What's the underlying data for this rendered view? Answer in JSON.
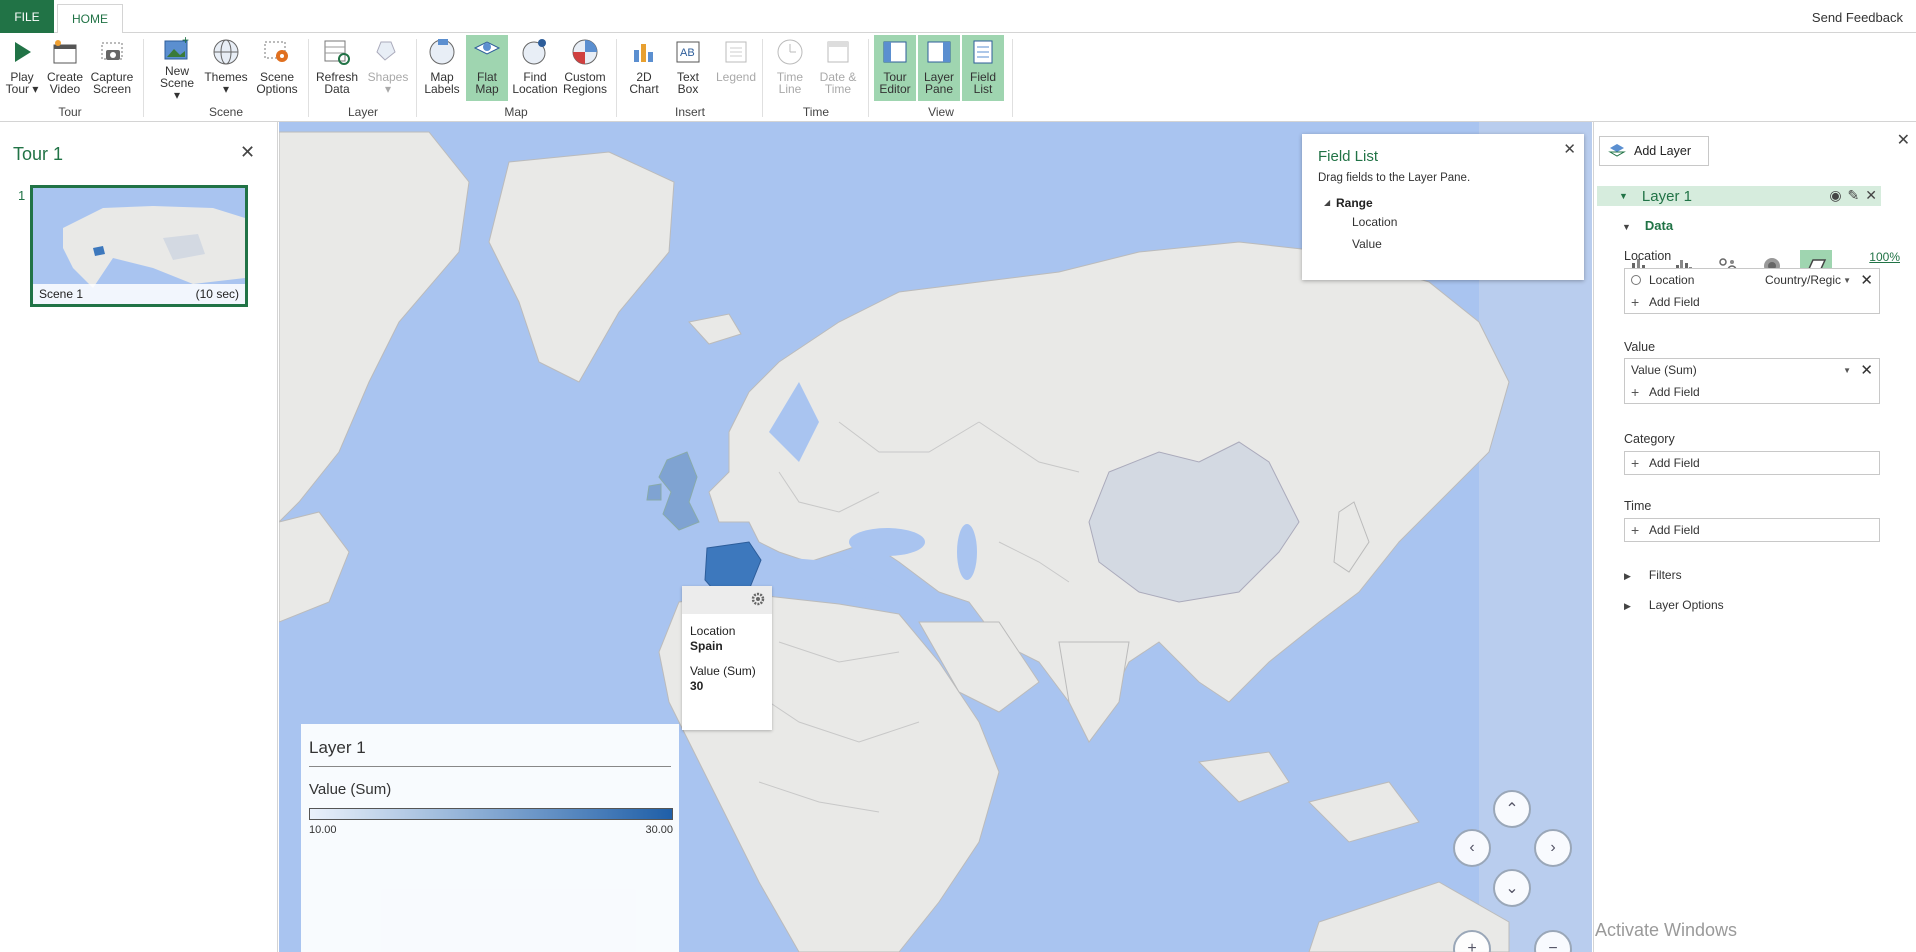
{
  "tabs": {
    "file": "FILE",
    "home": "HOME",
    "send_feedback": "Send Feedback"
  },
  "ribbon": {
    "groups": {
      "tour": "Tour",
      "scene": "Scene",
      "layer": "Layer",
      "map": "Map",
      "insert": "Insert",
      "time": "Time",
      "view": "View"
    },
    "buttons": {
      "play_tour": [
        "Play",
        "Tour ▾"
      ],
      "create_video": [
        "Create",
        "Video"
      ],
      "capture_screen": [
        "Capture",
        "Screen"
      ],
      "new_scene": [
        "New",
        "Scene ▾"
      ],
      "themes": [
        "Themes",
        "▾"
      ],
      "scene_options": [
        "Scene",
        "Options"
      ],
      "refresh_data": [
        "Refresh",
        "Data"
      ],
      "shapes": [
        "Shapes",
        "▾"
      ],
      "map_labels": [
        "Map",
        "Labels"
      ],
      "flat_map": [
        "Flat",
        "Map"
      ],
      "find_location": [
        "Find",
        "Location"
      ],
      "custom_regions": [
        "Custom",
        "Regions"
      ],
      "chart_2d": [
        "2D",
        "Chart"
      ],
      "text_box": [
        "Text",
        "Box"
      ],
      "legend": [
        "Legend",
        ""
      ],
      "time_line": [
        "Time",
        "Line"
      ],
      "date_time": [
        "Date &",
        "Time"
      ],
      "tour_editor": [
        "Tour",
        "Editor"
      ],
      "layer_pane": [
        "Layer",
        "Pane"
      ],
      "field_list": [
        "Field",
        "List"
      ]
    }
  },
  "tour_pane": {
    "title": "Tour 1",
    "close": "✕",
    "scenes": [
      {
        "number": "1",
        "name": "Scene 1",
        "duration": "(10 sec)"
      }
    ]
  },
  "legend": {
    "title": "Layer 1",
    "field": "Value (Sum)",
    "min": "10.00",
    "max": "30.00"
  },
  "tooltip": {
    "location_label": "Location",
    "location_value": "Spain",
    "value_label": "Value (Sum)",
    "value_value": "30"
  },
  "field_list": {
    "title": "Field List",
    "hint": "Drag fields to the Layer Pane.",
    "table": "Range",
    "fields": [
      "Location",
      "Value"
    ]
  },
  "layer_pane": {
    "add_layer": "Add Layer",
    "layer_name": "Layer 1",
    "data_heading": "Data",
    "location_label": "Location",
    "location_pct": "100%",
    "location_field": "Location",
    "location_type": "Country/Regic",
    "add_field": "Add Field",
    "value_label": "Value",
    "value_field": "Value (Sum)",
    "category_label": "Category",
    "time_label": "Time",
    "filters": "Filters",
    "layer_options": "Layer Options"
  },
  "watermark": "Activate Windows",
  "colors": {
    "accent": "#217346",
    "active_bg": "#9fd5b0",
    "ocean": "#a9c4f0",
    "land": "#e9e9e7",
    "spain": "#3d78bd",
    "uk": "#7fa3d2",
    "china": "#d3d9e2"
  }
}
